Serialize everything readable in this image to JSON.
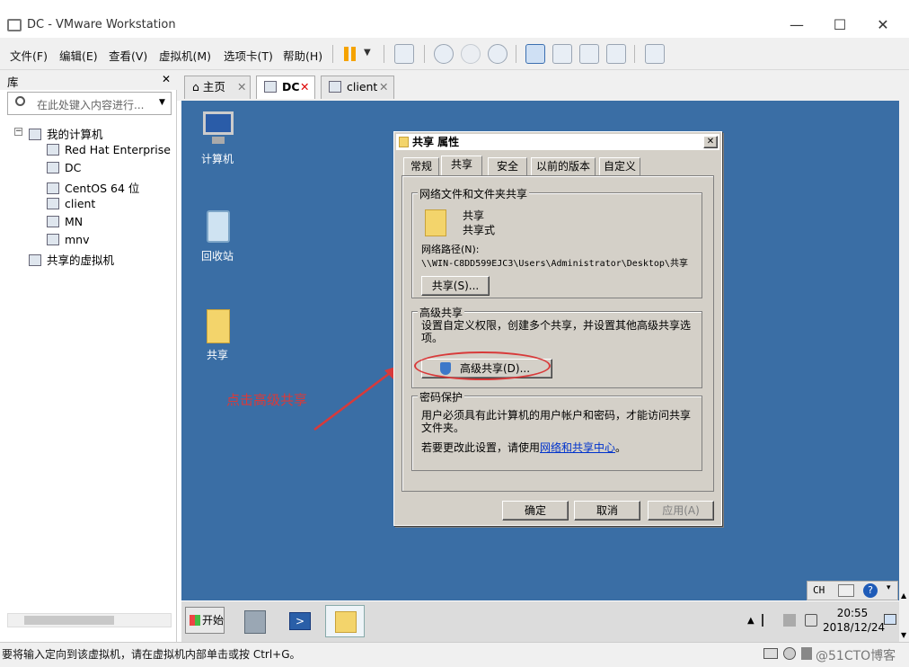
{
  "window": {
    "title": "DC - VMware Workstation",
    "minimize": "—",
    "maximize": "☐",
    "close": "✕"
  },
  "menu": [
    "文件(F)",
    "编辑(E)",
    "查看(V)",
    "虚拟机(M)",
    "选项卡(T)",
    "帮助(H)"
  ],
  "library": {
    "title": "库",
    "close": "✕",
    "search_placeholder": "在此处键入内容进行...",
    "tree": [
      {
        "label": "我的计算机",
        "level": 0
      },
      {
        "label": "Red Hat Enterprise L",
        "level": 1
      },
      {
        "label": "DC",
        "level": 1
      },
      {
        "label": "CentOS 64 位",
        "level": 1
      },
      {
        "label": "client",
        "level": 1
      },
      {
        "label": "MN",
        "level": 1
      },
      {
        "label": "mnv",
        "level": 1
      },
      {
        "label": "共享的虚拟机",
        "level": 0
      }
    ]
  },
  "tabs": [
    {
      "label": "主页",
      "close": "✕"
    },
    {
      "label": "DC",
      "close": "✕"
    },
    {
      "label": "client",
      "close": "✕"
    }
  ],
  "desktop": {
    "icons": [
      {
        "label": "计算机",
        "icon": "computer-icon"
      },
      {
        "label": "回收站",
        "icon": "recycle-bin-icon"
      },
      {
        "label": "共享",
        "icon": "folder-icon"
      }
    ],
    "annotation": "点击高级共享",
    "annotation_color": "#d83a3a"
  },
  "dialog": {
    "title": "共享 属性",
    "close": "✕",
    "tabs": [
      "常规",
      "共享",
      "安全",
      "以前的版本",
      "自定义"
    ],
    "active_tab": "共享",
    "network_group": {
      "label": "网络文件和文件夹共享",
      "name": "共享",
      "type": "共享式",
      "path_label": "网络路径(N):",
      "path": "\\\\WIN-C8DD599EJC3\\Users\\Administrator\\Desktop\\共享",
      "share_button": "共享(S)..."
    },
    "advanced_group": {
      "label": "高级共享",
      "desc": "设置自定义权限，创建多个共享，并设置其他高级共享选项。",
      "button": "高级共享(D)..."
    },
    "password_group": {
      "label": "密码保护",
      "desc": "用户必须具有此计算机的用户帐户和密码，才能访问共享文件夹。",
      "change_prefix": "若要更改此设置，请使用",
      "link": "网络和共享中心",
      "change_suffix": "。"
    },
    "ok": "确定",
    "cancel": "取消",
    "apply": "应用(A)"
  },
  "taskbar": {
    "start": "开始",
    "lang": "CH",
    "time": "20:55",
    "date": "2018/12/24"
  },
  "status": {
    "text": "要将输入定向到该虚拟机，请在虚拟机内部单击或按 Ctrl+G。",
    "watermark": "@51CTO博客"
  }
}
